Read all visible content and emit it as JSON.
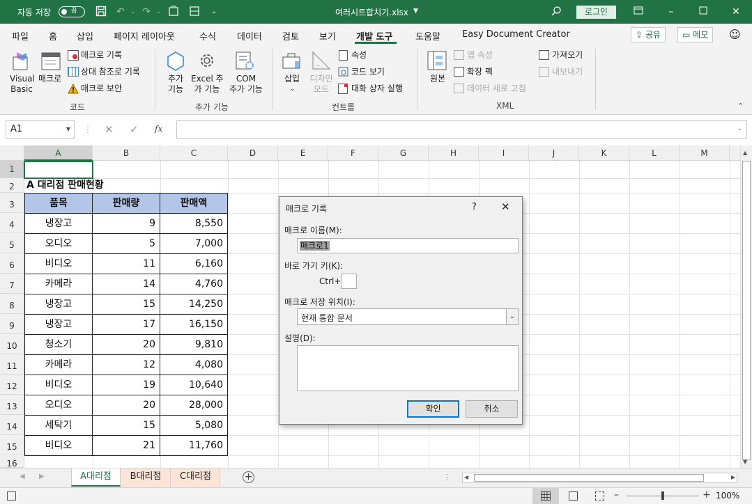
{
  "titlebar": {
    "autosave_label": "자동 저장",
    "autosave_state": "끔",
    "filename": "여러시트합치기.xlsx",
    "login_label": "로그인"
  },
  "menu": {
    "tabs": [
      "파일",
      "홈",
      "삽입",
      "페이지 레이아웃",
      "수식",
      "데이터",
      "검토",
      "보기",
      "개발 도구",
      "도움말",
      "Easy Document Creator"
    ],
    "active_tab": "개발 도구",
    "share_label": "공유",
    "memo_label": "메모"
  },
  "ribbon": {
    "code": {
      "visual_basic": [
        "Visual",
        "Basic"
      ],
      "macro": "매크로",
      "record_macro": "매크로 기록",
      "relative_ref": "상대 참조로 기록",
      "macro_security": "매크로 보안",
      "group": "코드"
    },
    "addins": {
      "addins": [
        "추가",
        "기능"
      ],
      "excel_addins": [
        "Excel 추",
        "가 기능"
      ],
      "com_addins": [
        "COM",
        "추가 기능"
      ],
      "group": "추가 기능"
    },
    "controls": {
      "insert": "삽입",
      "design_mode": [
        "디자인",
        "모드"
      ],
      "properties": "속성",
      "view_code": "코드 보기",
      "run_dialog": "대화 상자 실행",
      "group": "컨트롤"
    },
    "xml": {
      "source": "원본",
      "map_props": "맵 속성",
      "expansion_packs": "확장 팩",
      "refresh_data": "데이터 새로 고침",
      "import": "가져오기",
      "export": "내보내기",
      "group": "XML"
    }
  },
  "formula_bar": {
    "name_box": "A1",
    "fx": "fx",
    "formula": ""
  },
  "columns": [
    "A",
    "B",
    "C",
    "D",
    "E",
    "F",
    "G",
    "H",
    "I",
    "J",
    "K",
    "L",
    "M"
  ],
  "rows": [
    "1",
    "2",
    "3",
    "4",
    "5",
    "6",
    "7",
    "8",
    "9",
    "10",
    "11",
    "12",
    "13",
    "14",
    "15",
    "16"
  ],
  "sheet": {
    "title": "A 대리점 판매현황",
    "headers": [
      "품목",
      "판매량",
      "판매액"
    ],
    "data": [
      [
        "냉장고",
        "9",
        "8,550"
      ],
      [
        "오디오",
        "5",
        "7,000"
      ],
      [
        "비디오",
        "11",
        "6,160"
      ],
      [
        "카메라",
        "14",
        "4,760"
      ],
      [
        "냉장고",
        "15",
        "14,250"
      ],
      [
        "냉장고",
        "17",
        "16,150"
      ],
      [
        "청소기",
        "20",
        "9,810"
      ],
      [
        "카메라",
        "12",
        "4,080"
      ],
      [
        "비디오",
        "19",
        "10,640"
      ],
      [
        "오디오",
        "20",
        "28,000"
      ],
      [
        "세탁기",
        "15",
        "5,080"
      ],
      [
        "비디오",
        "21",
        "11,760"
      ]
    ]
  },
  "sheet_tabs": [
    "A대리점",
    "B대리점",
    "C대리점"
  ],
  "active_sheet": "A대리점",
  "colors": {
    "excel_green": "#217346",
    "header_fill": "#b4c6e7",
    "tab_orange": "#fce4d6"
  },
  "status": {
    "zoom": "100%",
    "zoom_fraction": 0.5
  },
  "dialog": {
    "title": "매크로 기록",
    "help": "?",
    "macro_name_label": "매크로 이름(M):",
    "macro_name_value": "매크로1",
    "shortcut_label": "바로 가기 키(K):",
    "ctrl_label": "Ctrl+",
    "store_label": "매크로 저장 위치(I):",
    "store_value": "현재 통합 문서",
    "description_label": "설명(D):",
    "ok": "확인",
    "cancel": "취소"
  }
}
